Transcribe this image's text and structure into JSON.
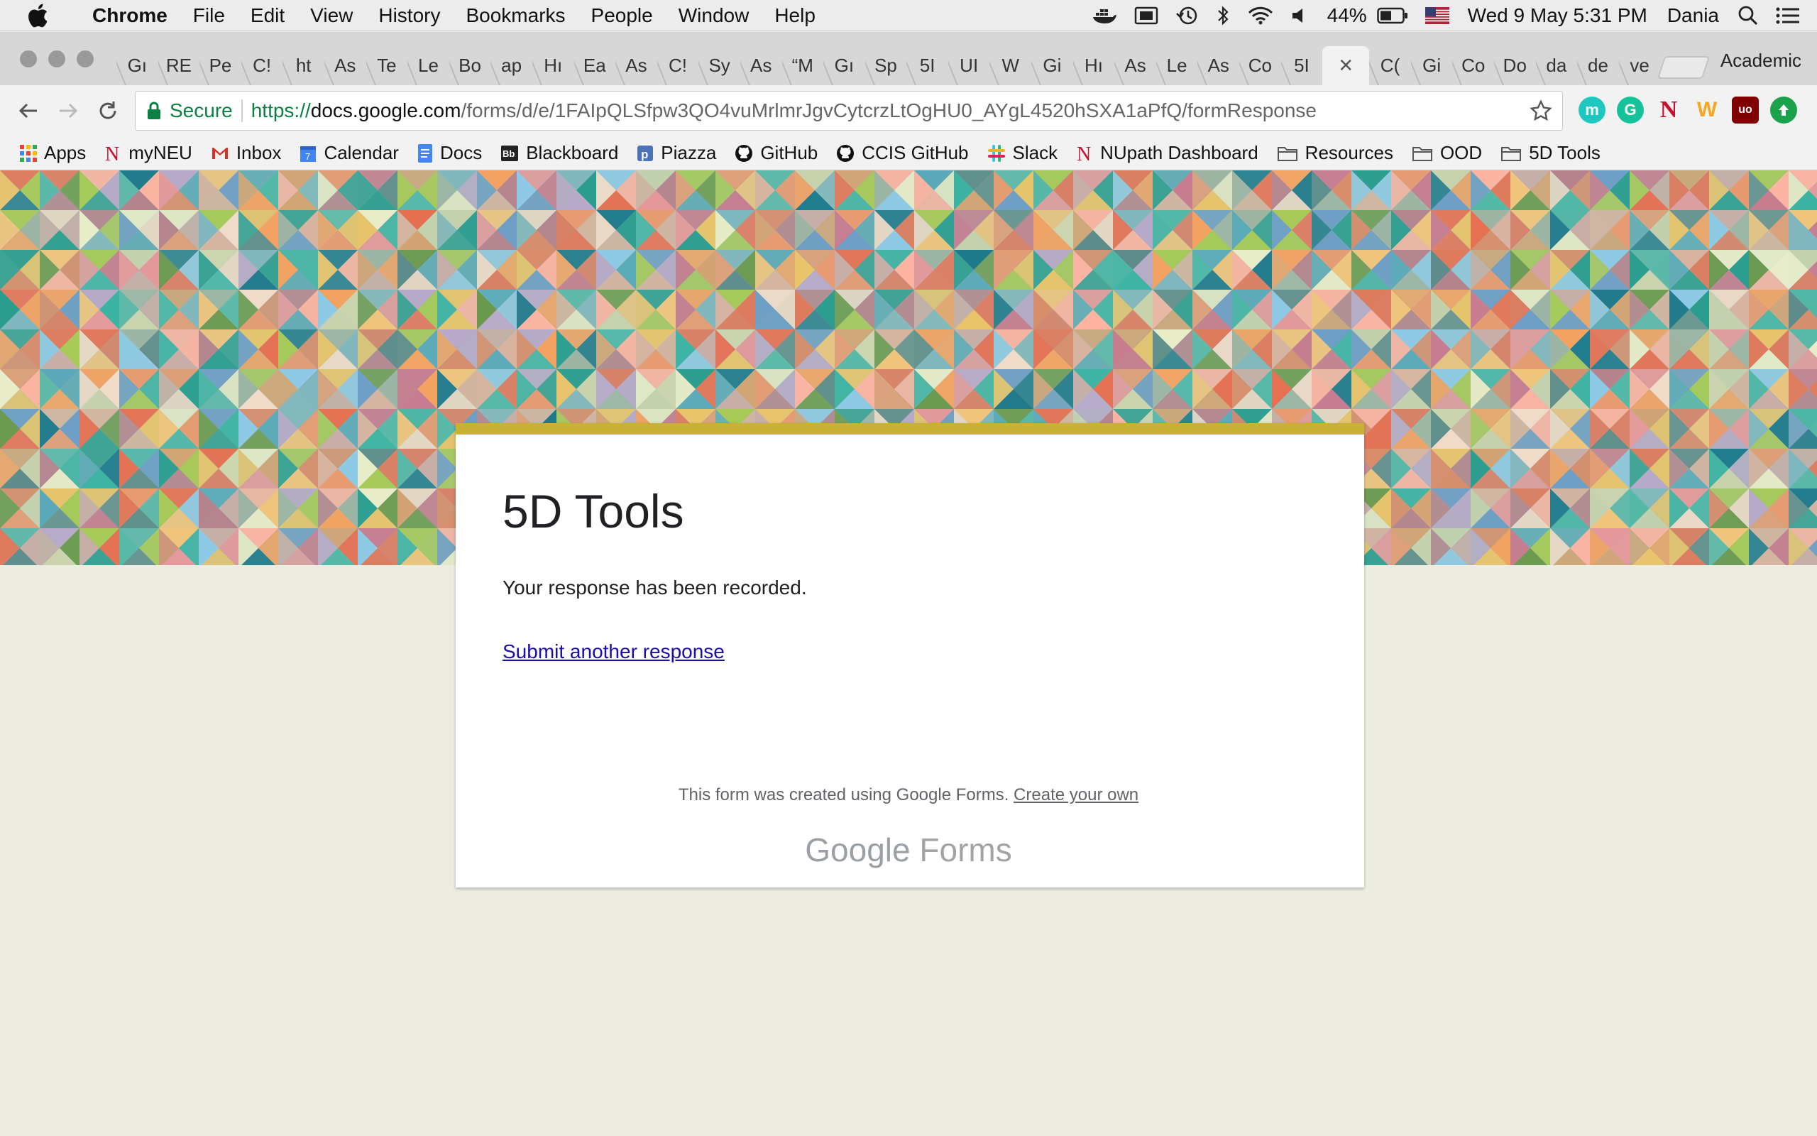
{
  "menubar": {
    "app": "Chrome",
    "items": [
      "File",
      "Edit",
      "View",
      "History",
      "Bookmarks",
      "People",
      "Window",
      "Help"
    ],
    "battery": "44%",
    "datetime": "Wed 9 May  5:31 PM",
    "user": "Dania"
  },
  "tabs": {
    "labels": [
      "Gı",
      "RE",
      "Pe",
      "C!",
      "ht",
      "As",
      "Te",
      "Le",
      "Bo",
      "ap",
      "Hı",
      "Ea",
      "As",
      "C!",
      "Sy",
      "As",
      "“M",
      "Gı",
      "Sp",
      "5I",
      "UI",
      "W",
      "Gi",
      "Hı",
      "As",
      "Le",
      "As",
      "Co",
      "5I",
      "×",
      "C(",
      "Gi",
      "Co",
      "Do",
      "da",
      "de",
      "ve"
    ],
    "active_index": 29,
    "profile": "Academic"
  },
  "omnibox": {
    "secure_label": "Secure",
    "scheme": "https://",
    "host": "docs.google.com",
    "path": "/forms/d/e/1FAIpQLSfpw3QO4vuMrlmrJgvCytcrzLtOgHU0_AYgL4520hSXA1aPfQ/formResponse"
  },
  "bookmarks": [
    {
      "label": "Apps",
      "icon": "apps-grid-icon"
    },
    {
      "label": "myNEU",
      "icon": "northeastern-n-icon"
    },
    {
      "label": "Inbox",
      "icon": "gmail-icon"
    },
    {
      "label": "Calendar",
      "icon": "calendar-icon"
    },
    {
      "label": "Docs",
      "icon": "docs-icon"
    },
    {
      "label": "Blackboard",
      "icon": "blackboard-icon"
    },
    {
      "label": "Piazza",
      "icon": "piazza-icon"
    },
    {
      "label": "GitHub",
      "icon": "github-icon"
    },
    {
      "label": "CCIS GitHub",
      "icon": "github-icon"
    },
    {
      "label": "Slack",
      "icon": "slack-icon"
    },
    {
      "label": "NUpath Dashboard",
      "icon": "northeastern-n-icon"
    },
    {
      "label": "Resources",
      "icon": "folder-icon"
    },
    {
      "label": "OOD",
      "icon": "folder-icon"
    },
    {
      "label": "5D Tools",
      "icon": "folder-icon"
    }
  ],
  "form": {
    "title": "5D Tools",
    "confirmation": "Your response has been recorded.",
    "submit_another": "Submit another response",
    "accent_color": "#c9b037"
  },
  "footer": {
    "note": "This form was created using Google Forms.",
    "create_link": "Create your own",
    "logo_google": "Google",
    "logo_forms": "Forms"
  }
}
